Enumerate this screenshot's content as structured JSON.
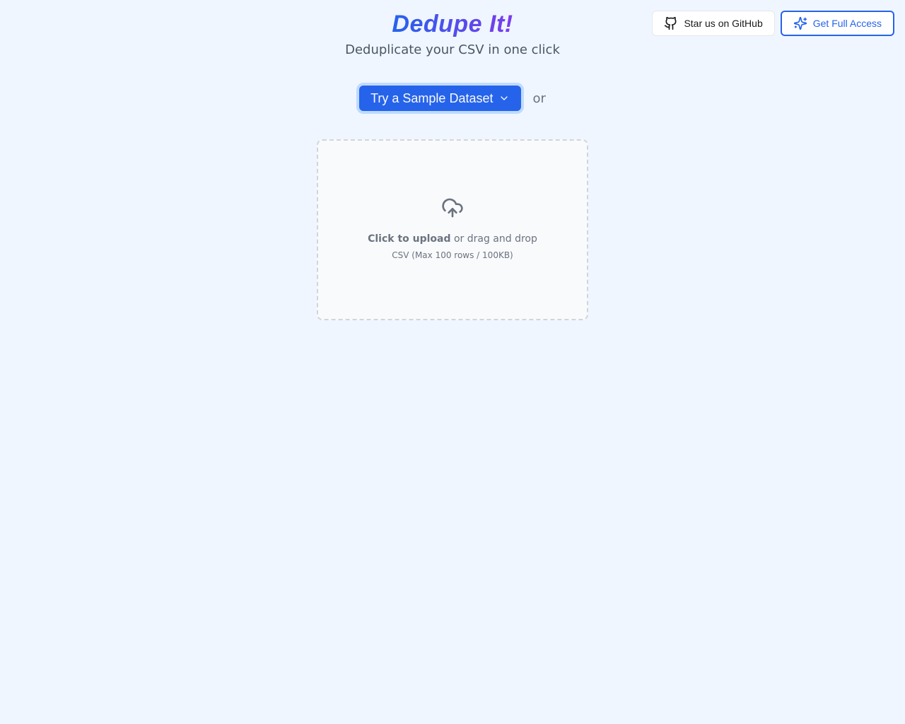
{
  "header": {
    "github_label": "Star us on GitHub",
    "full_access_label": "Get Full Access"
  },
  "hero": {
    "logo_text": "Dedupe It!",
    "tagline": "Deduplicate your CSV in one click"
  },
  "actions": {
    "sample_button_label": "Try a Sample Dataset",
    "or_label": "or",
    "upload_bold": "Click to upload",
    "upload_rest": " or drag and drop",
    "upload_hint": "CSV (Max 100 rows / 100KB)"
  }
}
